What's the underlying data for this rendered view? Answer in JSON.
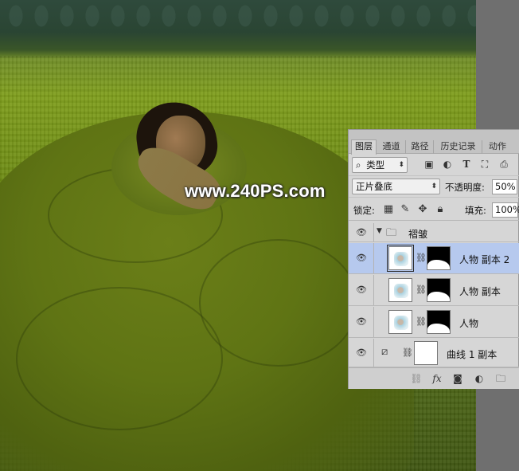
{
  "watermark": "www.240PS.com",
  "panel": {
    "tabs": [
      {
        "label": "图层",
        "active": true
      },
      {
        "label": "通道",
        "active": false
      },
      {
        "label": "路径",
        "active": false
      },
      {
        "label": "历史记录",
        "active": false
      },
      {
        "label": "动作",
        "active": false
      }
    ],
    "filter": {
      "kind_label": "类型",
      "search_glyph": "⌕",
      "icons": [
        "image-filter-icon",
        "adjustment-filter-icon",
        "type-filter-icon",
        "shape-filter-icon",
        "smart-object-filter-icon"
      ]
    },
    "blend": {
      "mode": "正片叠底",
      "opacity_label": "不透明度:",
      "opacity_value": "50%"
    },
    "lock": {
      "label": "锁定:",
      "fill_label": "填充:",
      "fill_value": "100%"
    },
    "layers": [
      {
        "name": "褶皱",
        "type": "group",
        "selected": false,
        "visible": true
      },
      {
        "name": "人物 副本 2",
        "type": "masked",
        "selected": true,
        "visible": true
      },
      {
        "name": "人物 副本",
        "type": "masked",
        "selected": false,
        "visible": true
      },
      {
        "name": "人物",
        "type": "masked",
        "selected": false,
        "visible": true
      },
      {
        "name": "曲线 1 副本",
        "type": "adjustment",
        "selected": false,
        "visible": true
      }
    ],
    "bottom_icons": [
      "link-icon",
      "fx-icon",
      "add-mask-icon",
      "new-adjustment-icon",
      "new-group-icon"
    ],
    "fx_label": "fx"
  },
  "colors": {
    "selected_row": "#b6c9ee",
    "panel_bg": "#d6d6d6",
    "canvas_gutter": "#6f6f6f"
  }
}
